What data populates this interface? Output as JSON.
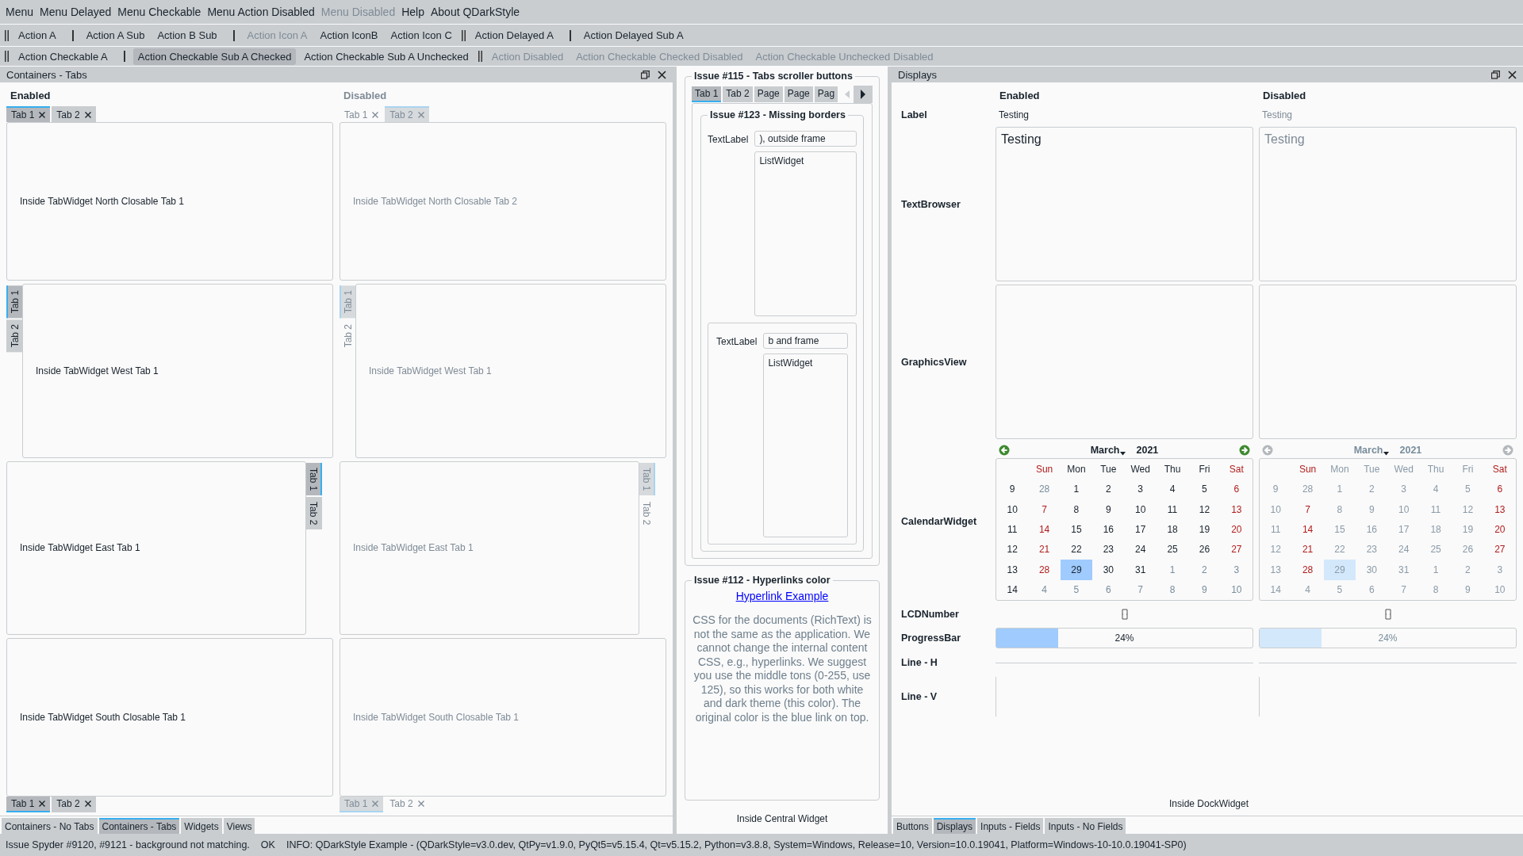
{
  "menu_bar": [
    {
      "label": "Menu",
      "disabled": false
    },
    {
      "label": "Menu Delayed",
      "disabled": false
    },
    {
      "label": "Menu Checkable",
      "disabled": false
    },
    {
      "label": "Menu Action Disabled",
      "disabled": false
    },
    {
      "label": "Menu Disabled",
      "disabled": true
    },
    {
      "label": "Help",
      "disabled": false
    },
    {
      "label": "About QDarkStyle",
      "disabled": false
    }
  ],
  "toolbars": [
    [
      {
        "kind": "handle"
      },
      {
        "kind": "action",
        "label": "Action A",
        "disabled": false,
        "checked": false
      },
      {
        "kind": "separator"
      },
      {
        "kind": "action",
        "label": "Action A Sub",
        "disabled": false,
        "checked": false
      },
      {
        "kind": "action",
        "label": "Action B Sub",
        "disabled": false,
        "checked": false
      },
      {
        "kind": "separator"
      },
      {
        "kind": "action",
        "label": "Action Icon A",
        "disabled": true,
        "checked": false
      },
      {
        "kind": "action",
        "label": "Action IconB",
        "disabled": false,
        "checked": false
      },
      {
        "kind": "action",
        "label": "Action Icon C",
        "disabled": false,
        "checked": false
      },
      {
        "kind": "handle"
      },
      {
        "kind": "action",
        "label": "Action Delayed A",
        "disabled": false,
        "checked": false
      },
      {
        "kind": "separator"
      },
      {
        "kind": "action",
        "label": "Action Delayed Sub A",
        "disabled": false,
        "checked": false
      }
    ],
    [
      {
        "kind": "handle"
      },
      {
        "kind": "action",
        "label": "Action Checkable A",
        "disabled": false,
        "checked": false
      },
      {
        "kind": "separator"
      },
      {
        "kind": "action",
        "label": "Action Checkable Sub A Checked",
        "disabled": false,
        "checked": true
      },
      {
        "kind": "action",
        "label": "Action Checkable Sub A Unchecked",
        "disabled": false,
        "checked": false
      },
      {
        "kind": "handle"
      },
      {
        "kind": "action",
        "label": "Action Disabled",
        "disabled": true,
        "checked": false
      },
      {
        "kind": "action",
        "label": "Action Checkable Checked Disabled",
        "disabled": true,
        "checked": false
      },
      {
        "kind": "action",
        "label": "Action Checkable Unchecked Disabled",
        "disabled": true,
        "checked": false
      }
    ]
  ],
  "left_dock": {
    "title": "Containers - Tabs",
    "columns": [
      {
        "heading": "Enabled",
        "disabled": false,
        "tab_widgets": [
          {
            "kind": "north",
            "tabs": [
              {
                "label": "Tab 1",
                "closable": true,
                "selected": true
              },
              {
                "label": "Tab 2",
                "closable": true,
                "selected": false
              }
            ],
            "content": "Inside TabWidget North Closable Tab 1"
          },
          {
            "kind": "west",
            "tabs": [
              {
                "label": "Tab 1",
                "closable": false,
                "selected": true
              },
              {
                "label": "Tab 2",
                "closable": false,
                "selected": false
              }
            ],
            "content": "Inside TabWidget West Tab 1"
          },
          {
            "kind": "east",
            "tabs": [
              {
                "label": "Tab 1",
                "closable": false,
                "selected": true
              },
              {
                "label": "Tab 2",
                "closable": false,
                "selected": false
              }
            ],
            "content": "Inside TabWidget East Tab 1"
          },
          {
            "kind": "south",
            "tabs": [
              {
                "label": "Tab 1",
                "closable": true,
                "selected": true
              },
              {
                "label": "Tab 2",
                "closable": true,
                "selected": false
              }
            ],
            "content": "Inside TabWidget South Closable Tab 1"
          }
        ]
      },
      {
        "heading": "Disabled",
        "disabled": true,
        "tab_widgets": [
          {
            "kind": "north",
            "tabs": [
              {
                "label": "Tab 1",
                "closable": true,
                "selected": false
              },
              {
                "label": "Tab 2",
                "closable": true,
                "selected": true
              }
            ],
            "content": "Inside TabWidget North Closable Tab 2"
          },
          {
            "kind": "west",
            "tabs": [
              {
                "label": "Tab 1",
                "closable": false,
                "selected": true
              },
              {
                "label": "Tab 2",
                "closable": false,
                "selected": false
              }
            ],
            "content": "Inside TabWidget West Tab 1"
          },
          {
            "kind": "east",
            "tabs": [
              {
                "label": "Tab 1",
                "closable": false,
                "selected": true
              },
              {
                "label": "Tab 2",
                "closable": false,
                "selected": false
              }
            ],
            "content": "Inside TabWidget East Tab 1"
          },
          {
            "kind": "south",
            "tabs": [
              {
                "label": "Tab 1",
                "closable": true,
                "selected": true
              },
              {
                "label": "Tab 2",
                "closable": true,
                "selected": false
              }
            ],
            "content": "Inside TabWidget South Closable Tab 1"
          }
        ]
      }
    ],
    "bottom_tabs": [
      {
        "label": "Containers - No Tabs",
        "selected": false
      },
      {
        "label": "Containers - Tabs",
        "selected": true
      },
      {
        "label": "Widgets",
        "selected": false
      },
      {
        "label": "Views",
        "selected": false
      }
    ]
  },
  "central": {
    "scroller_group": {
      "title": "Issue #115 - Tabs scroller buttons",
      "tabs": [
        {
          "label": "Tab 1",
          "selected": true
        },
        {
          "label": "Tab 2",
          "selected": false
        },
        {
          "label": "Page",
          "selected": false
        },
        {
          "label": "Page",
          "selected": false
        },
        {
          "label": "Pag",
          "selected": false
        }
      ],
      "borders_group": {
        "title": "Issue #123 - Missing borders",
        "label": "TextLabel",
        "field_value": "), outside frame",
        "list": "ListWidget",
        "frame": {
          "label": "TextLabel",
          "field_value": "b and frame",
          "list": "ListWidget"
        }
      }
    },
    "hyperlink_group": {
      "title": "Issue #112 - Hyperlinks color",
      "link": "Hyperlink Example",
      "text": "CSS for the documents (RichText) is not the same as the application. We cannot change the internal content CSS, e.g., hyperlinks. We suggest you use the middle tons (0-255, use 125), so this works for both white and dark theme (this color). The original color is the blue link on top."
    },
    "footer": "Inside Central Widget"
  },
  "right_dock": {
    "title": "Displays",
    "row_labels": [
      "Label",
      "TextBrowser",
      "GraphicsView",
      "CalendarWidget",
      "LCDNumber",
      "ProgressBar",
      "Line - H",
      "Line - V"
    ],
    "columns": [
      {
        "heading": "Enabled",
        "disabled": false,
        "label": "Testing",
        "text_browser": "Testing",
        "calendar": {
          "month": "March",
          "year": "2021",
          "weekdays": [
            "Sun",
            "Mon",
            "Tue",
            "Wed",
            "Thu",
            "Fri",
            "Sat"
          ],
          "weeks": [
            {
              "week": "9",
              "days": [
                {
                  "day": "28",
                  "outside": true,
                  "selected": false
                },
                {
                  "day": "1",
                  "outside": false,
                  "selected": false
                },
                {
                  "day": "2",
                  "outside": false,
                  "selected": false
                },
                {
                  "day": "3",
                  "outside": false,
                  "selected": false
                },
                {
                  "day": "4",
                  "outside": false,
                  "selected": false
                },
                {
                  "day": "5",
                  "outside": false,
                  "selected": false
                },
                {
                  "day": "6",
                  "outside": false,
                  "selected": false
                }
              ]
            },
            {
              "week": "10",
              "days": [
                {
                  "day": "7",
                  "outside": false,
                  "selected": false
                },
                {
                  "day": "8",
                  "outside": false,
                  "selected": false
                },
                {
                  "day": "9",
                  "outside": false,
                  "selected": false
                },
                {
                  "day": "10",
                  "outside": false,
                  "selected": false
                },
                {
                  "day": "11",
                  "outside": false,
                  "selected": false
                },
                {
                  "day": "12",
                  "outside": false,
                  "selected": false
                },
                {
                  "day": "13",
                  "outside": false,
                  "selected": false
                }
              ]
            },
            {
              "week": "11",
              "days": [
                {
                  "day": "14",
                  "outside": false,
                  "selected": false
                },
                {
                  "day": "15",
                  "outside": false,
                  "selected": false
                },
                {
                  "day": "16",
                  "outside": false,
                  "selected": false
                },
                {
                  "day": "17",
                  "outside": false,
                  "selected": false
                },
                {
                  "day": "18",
                  "outside": false,
                  "selected": false
                },
                {
                  "day": "19",
                  "outside": false,
                  "selected": false
                },
                {
                  "day": "20",
                  "outside": false,
                  "selected": false
                }
              ]
            },
            {
              "week": "12",
              "days": [
                {
                  "day": "21",
                  "outside": false,
                  "selected": false
                },
                {
                  "day": "22",
                  "outside": false,
                  "selected": false
                },
                {
                  "day": "23",
                  "outside": false,
                  "selected": false
                },
                {
                  "day": "24",
                  "outside": false,
                  "selected": false
                },
                {
                  "day": "25",
                  "outside": false,
                  "selected": false
                },
                {
                  "day": "26",
                  "outside": false,
                  "selected": false
                },
                {
                  "day": "27",
                  "outside": false,
                  "selected": false
                }
              ]
            },
            {
              "week": "13",
              "days": [
                {
                  "day": "28",
                  "outside": false,
                  "selected": false
                },
                {
                  "day": "29",
                  "outside": false,
                  "selected": true
                },
                {
                  "day": "30",
                  "outside": false,
                  "selected": false
                },
                {
                  "day": "31",
                  "outside": false,
                  "selected": false
                },
                {
                  "day": "1",
                  "outside": true,
                  "selected": false
                },
                {
                  "day": "2",
                  "outside": true,
                  "selected": false
                },
                {
                  "day": "3",
                  "outside": true,
                  "selected": false
                }
              ]
            },
            {
              "week": "14",
              "days": [
                {
                  "day": "4",
                  "outside": true,
                  "selected": false
                },
                {
                  "day": "5",
                  "outside": true,
                  "selected": false
                },
                {
                  "day": "6",
                  "outside": true,
                  "selected": false
                },
                {
                  "day": "7",
                  "outside": true,
                  "selected": false
                },
                {
                  "day": "8",
                  "outside": true,
                  "selected": false
                },
                {
                  "day": "9",
                  "outside": true,
                  "selected": false
                },
                {
                  "day": "10",
                  "outside": true,
                  "selected": false
                }
              ]
            }
          ]
        },
        "progress": {
          "level": 0.24,
          "reading": "24%"
        }
      },
      {
        "heading": "Disabled",
        "disabled": true,
        "label": "Testing",
        "text_browser": "Testing",
        "calendar": {
          "month": "March",
          "year": "2021",
          "weekdays": [
            "Sun",
            "Mon",
            "Tue",
            "Wed",
            "Thu",
            "Fri",
            "Sat"
          ],
          "weeks": [
            {
              "week": "9",
              "days": [
                {
                  "day": "28",
                  "outside": true,
                  "selected": false
                },
                {
                  "day": "1",
                  "outside": false,
                  "selected": false
                },
                {
                  "day": "2",
                  "outside": false,
                  "selected": false
                },
                {
                  "day": "3",
                  "outside": false,
                  "selected": false
                },
                {
                  "day": "4",
                  "outside": false,
                  "selected": false
                },
                {
                  "day": "5",
                  "outside": false,
                  "selected": false
                },
                {
                  "day": "6",
                  "outside": false,
                  "selected": false
                }
              ]
            },
            {
              "week": "10",
              "days": [
                {
                  "day": "7",
                  "outside": false,
                  "selected": false
                },
                {
                  "day": "8",
                  "outside": false,
                  "selected": false
                },
                {
                  "day": "9",
                  "outside": false,
                  "selected": false
                },
                {
                  "day": "10",
                  "outside": false,
                  "selected": false
                },
                {
                  "day": "11",
                  "outside": false,
                  "selected": false
                },
                {
                  "day": "12",
                  "outside": false,
                  "selected": false
                },
                {
                  "day": "13",
                  "outside": false,
                  "selected": false
                }
              ]
            },
            {
              "week": "11",
              "days": [
                {
                  "day": "14",
                  "outside": false,
                  "selected": false
                },
                {
                  "day": "15",
                  "outside": false,
                  "selected": false
                },
                {
                  "day": "16",
                  "outside": false,
                  "selected": false
                },
                {
                  "day": "17",
                  "outside": false,
                  "selected": false
                },
                {
                  "day": "18",
                  "outside": false,
                  "selected": false
                },
                {
                  "day": "19",
                  "outside": false,
                  "selected": false
                },
                {
                  "day": "20",
                  "outside": false,
                  "selected": false
                }
              ]
            },
            {
              "week": "12",
              "days": [
                {
                  "day": "21",
                  "outside": false,
                  "selected": false
                },
                {
                  "day": "22",
                  "outside": false,
                  "selected": false
                },
                {
                  "day": "23",
                  "outside": false,
                  "selected": false
                },
                {
                  "day": "24",
                  "outside": false,
                  "selected": false
                },
                {
                  "day": "25",
                  "outside": false,
                  "selected": false
                },
                {
                  "day": "26",
                  "outside": false,
                  "selected": false
                },
                {
                  "day": "27",
                  "outside": false,
                  "selected": false
                }
              ]
            },
            {
              "week": "13",
              "days": [
                {
                  "day": "28",
                  "outside": false,
                  "selected": false
                },
                {
                  "day": "29",
                  "outside": false,
                  "selected": true
                },
                {
                  "day": "30",
                  "outside": false,
                  "selected": false
                },
                {
                  "day": "31",
                  "outside": false,
                  "selected": false
                },
                {
                  "day": "1",
                  "outside": true,
                  "selected": false
                },
                {
                  "day": "2",
                  "outside": true,
                  "selected": false
                },
                {
                  "day": "3",
                  "outside": true,
                  "selected": false
                }
              ]
            },
            {
              "week": "14",
              "days": [
                {
                  "day": "4",
                  "outside": true,
                  "selected": false
                },
                {
                  "day": "5",
                  "outside": true,
                  "selected": false
                },
                {
                  "day": "6",
                  "outside": true,
                  "selected": false
                },
                {
                  "day": "7",
                  "outside": true,
                  "selected": false
                },
                {
                  "day": "8",
                  "outside": true,
                  "selected": false
                },
                {
                  "day": "9",
                  "outside": true,
                  "selected": false
                },
                {
                  "day": "10",
                  "outside": true,
                  "selected": false
                }
              ]
            }
          ]
        },
        "progress": {
          "level": 0.24,
          "reading": "24%"
        }
      }
    ],
    "footer": "Inside DockWidget",
    "bottom_tabs": [
      {
        "label": "Buttons",
        "selected": false
      },
      {
        "label": "Displays",
        "selected": true
      },
      {
        "label": "Inputs - Fields",
        "selected": false
      },
      {
        "label": "Inputs - No Fields",
        "selected": false
      }
    ]
  },
  "status_bar": [
    "Issue Spyder #9120, #9121 - background not matching.",
    "OK",
    "INFO: QDarkStyle Example - (QDarkStyle=v3.0.dev, QtPy=v1.9.0, PyQt5=v5.15.4, Qt=v5.15.2, Python=v3.8.8, System=Windows, Release=10, Version=10.0.19041, Platform=Windows-10-10.0.19041-SP0)"
  ]
}
